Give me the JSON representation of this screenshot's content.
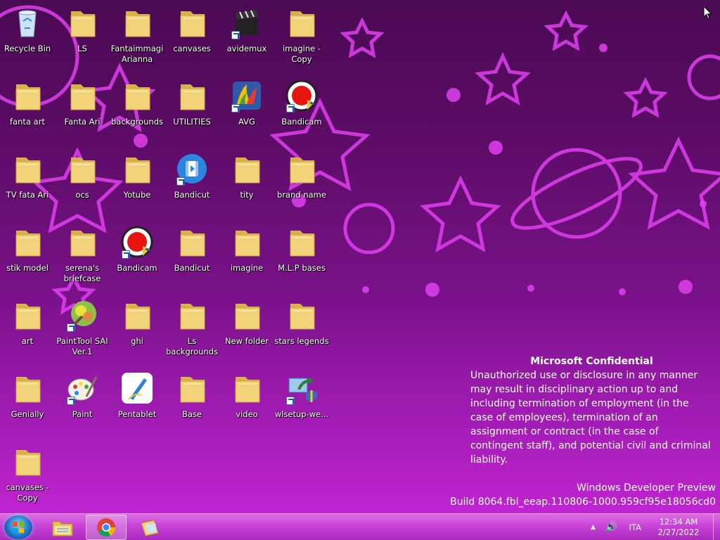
{
  "desktop": {
    "icons": [
      {
        "label": "Recycle Bin",
        "type": "recycle"
      },
      {
        "label": "LS",
        "type": "folder"
      },
      {
        "label": "Fantaimmagi Arianna",
        "type": "folder"
      },
      {
        "label": "canvases",
        "type": "folder"
      },
      {
        "label": "avidemux",
        "type": "app-clapper",
        "shortcut": true
      },
      {
        "label": "imagine - Copy",
        "type": "folder"
      },
      {
        "label": "fanta art",
        "type": "folder"
      },
      {
        "label": "Fanta Ari",
        "type": "folder"
      },
      {
        "label": "backgrounds",
        "type": "folder"
      },
      {
        "label": "UTILITIES",
        "type": "folder"
      },
      {
        "label": "AVG",
        "type": "app-avg",
        "shortcut": true
      },
      {
        "label": "Bandicam",
        "type": "app-bandicam",
        "shortcut": true
      },
      {
        "label": "TV  fata Ari",
        "type": "folder"
      },
      {
        "label": "ocs",
        "type": "folder"
      },
      {
        "label": "Yotube",
        "type": "folder"
      },
      {
        "label": "Bandicut",
        "type": "app-bandicut",
        "shortcut": true
      },
      {
        "label": "tity",
        "type": "folder"
      },
      {
        "label": "brand name",
        "type": "folder"
      },
      {
        "label": "stik  model",
        "type": "folder"
      },
      {
        "label": "serena's briefcase",
        "type": "folder"
      },
      {
        "label": "Bandicam",
        "type": "app-bandicam",
        "shortcut": true
      },
      {
        "label": "Bandicut",
        "type": "folder"
      },
      {
        "label": "imagine",
        "type": "folder"
      },
      {
        "label": "M.L.P bases",
        "type": "folder"
      },
      {
        "label": "art",
        "type": "folder"
      },
      {
        "label": "PaintTool SAI Ver.1",
        "type": "app-sai",
        "shortcut": true
      },
      {
        "label": "ghi",
        "type": "folder"
      },
      {
        "label": "Ls backgrounds",
        "type": "folder"
      },
      {
        "label": "New folder",
        "type": "folder"
      },
      {
        "label": "stars legends",
        "type": "folder"
      },
      {
        "label": "Genially",
        "type": "folder"
      },
      {
        "label": "Paint",
        "type": "app-paint",
        "shortcut": true
      },
      {
        "label": "Pentablet",
        "type": "app-pentablet"
      },
      {
        "label": "Base",
        "type": "folder"
      },
      {
        "label": "video",
        "type": "folder"
      },
      {
        "label": "wlsetup-we...",
        "type": "app-setup",
        "shortcut": true
      },
      {
        "label": "canvases - Copy",
        "type": "folder"
      }
    ]
  },
  "watermark": {
    "title": "Microsoft Confidential",
    "body": "Unauthorized use or disclosure in any manner may result in disciplinary action up to and including termination of employment (in the case of employees), termination of an assignment or contract (in the case of contingent staff), and potential civil and criminal liability.",
    "product": "Windows Developer Preview",
    "build": "Build 8064.fbl_eeap.110806-1000.959cf95e18056cd0"
  },
  "taskbar": {
    "start_icon": "windows-orb-icon",
    "pinned": [
      "file-explorer-icon",
      "chrome-icon",
      "folder-icon"
    ],
    "tray": {
      "arrow": "▲",
      "volume": "🔊",
      "language": "ITA",
      "time": "12:34 AM",
      "date": "2/27/2022"
    }
  },
  "colors": {
    "wallpaper_dark": "#4a0a52",
    "wallpaper_light": "#c726d8",
    "pattern": "#e040f0",
    "folder": "#f3d37a"
  }
}
